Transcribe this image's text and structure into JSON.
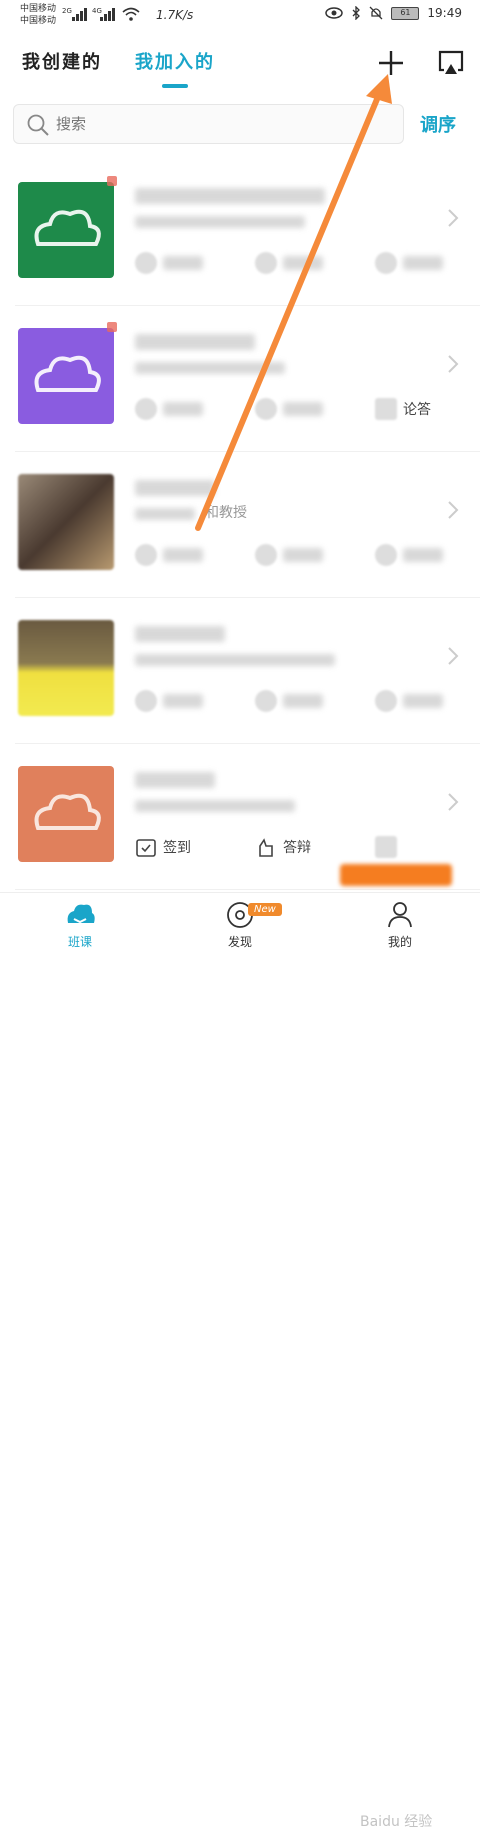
{
  "status_bar": {
    "carrier_1": "中国移动",
    "carrier_2": "中国移动",
    "network_1": "2G",
    "network_2": "4G",
    "net_speed": "1.7K/s",
    "battery": "61",
    "time": "19:49"
  },
  "tabs": {
    "created": "我创建的",
    "joined": "我加入的"
  },
  "search": {
    "placeholder": "搜索"
  },
  "sort_label": "调序",
  "courses": [
    {
      "cover_color": "#1e8a4a",
      "actions": [
        "",
        "",
        ""
      ]
    },
    {
      "cover_color": "#8a5ce0",
      "actions": [
        "",
        "",
        "论答"
      ]
    },
    {
      "cover_color": "#6b5a4a",
      "actions": [
        "",
        "",
        ""
      ]
    },
    {
      "cover_color": "#c8a060",
      "actions": [
        "",
        "",
        ""
      ]
    },
    {
      "cover_color": "#e0805c",
      "actions": [
        "签到",
        "答辩",
        ""
      ]
    }
  ],
  "second_course_snippet": "和教授",
  "bottom_nav": {
    "classes": "班课",
    "discover": "发现",
    "mine": "我的",
    "new_badge": "New"
  },
  "watermark": "Baidu 经验",
  "colors": {
    "accent": "#1aa5c9",
    "annotation_arrow": "#f58a3a"
  }
}
